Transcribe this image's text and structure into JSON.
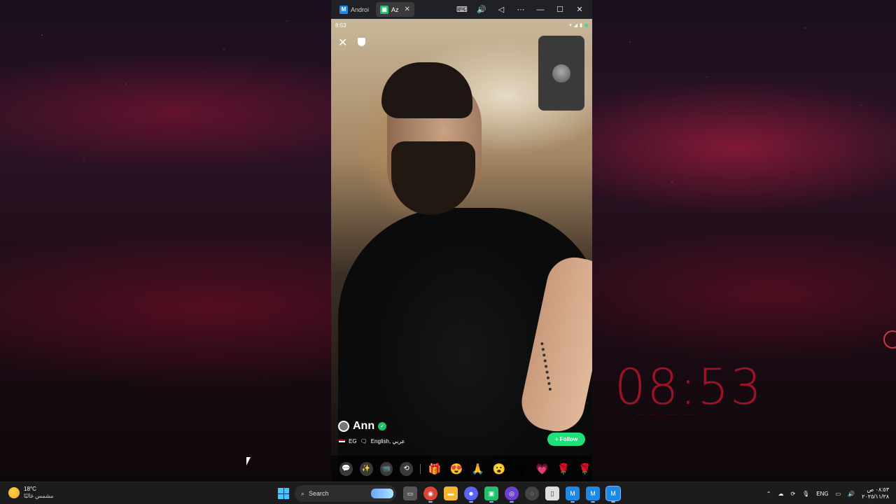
{
  "window": {
    "tabs": [
      {
        "label": "Androi",
        "active": false,
        "logo_color": "#1e88e5"
      },
      {
        "label": "Az",
        "active": true,
        "logo_color": "#21c16b"
      }
    ],
    "tab_close": "✕",
    "controls": {
      "keyboard": "⌨",
      "volume": "🔊",
      "back": "◁",
      "more": "⋯",
      "minimize": "—",
      "maximize": "☐",
      "close": "✕"
    }
  },
  "phone": {
    "status_time": "8:53",
    "close_label": "✕",
    "caller": {
      "name": "Ann",
      "country": "EG",
      "languages": "English, عربي",
      "verified_mark": "✓"
    },
    "follow_label": "+ Follow",
    "call_controls": [
      {
        "name": "chat-icon",
        "glyph": "💬"
      },
      {
        "name": "magic-wand-icon",
        "glyph": "✨"
      },
      {
        "name": "video-camera-icon",
        "glyph": "📹"
      },
      {
        "name": "switch-camera-icon",
        "glyph": "⟲"
      }
    ],
    "gifts": [
      "🎁",
      "😍",
      "🙏",
      "😮",
      "🎙",
      "💗",
      "🌹",
      "🌹"
    ]
  },
  "desktop": {
    "clock": "08:53",
    "clock_sub": "··· ··· ·· ····· ·····"
  },
  "taskbar": {
    "weather_temp": "18°C",
    "weather_desc": "مشمس غالبًا",
    "search_placeholder": "Search",
    "apps": [
      {
        "name": "file-icon",
        "glyph": "▭",
        "color": "#555"
      },
      {
        "name": "chrome-icon",
        "glyph": "◉",
        "color": "#db4437"
      },
      {
        "name": "folder-icon",
        "glyph": "▬",
        "color": "#f2b632"
      },
      {
        "name": "discord-icon",
        "glyph": "☻",
        "color": "#5865f2"
      },
      {
        "name": "android-studio-icon",
        "glyph": "▣",
        "color": "#21c16b"
      },
      {
        "name": "app-icon",
        "glyph": "◎",
        "color": "#6b3fd1"
      },
      {
        "name": "globe-icon",
        "glyph": "◌",
        "color": "#444"
      },
      {
        "name": "document-icon",
        "glyph": "▯",
        "color": "#ddd"
      },
      {
        "name": "emulator-icon",
        "glyph": "M",
        "color": "#1e88e5"
      },
      {
        "name": "emulator-icon-2",
        "glyph": "M",
        "color": "#1e88e5"
      },
      {
        "name": "emulator-icon-3",
        "glyph": "M",
        "color": "#1e88e5"
      }
    ],
    "tray": {
      "language": "ENG",
      "time": "٠٨:٥٣ ص",
      "date": "٢٠٢٥/١١/٢٨"
    }
  }
}
